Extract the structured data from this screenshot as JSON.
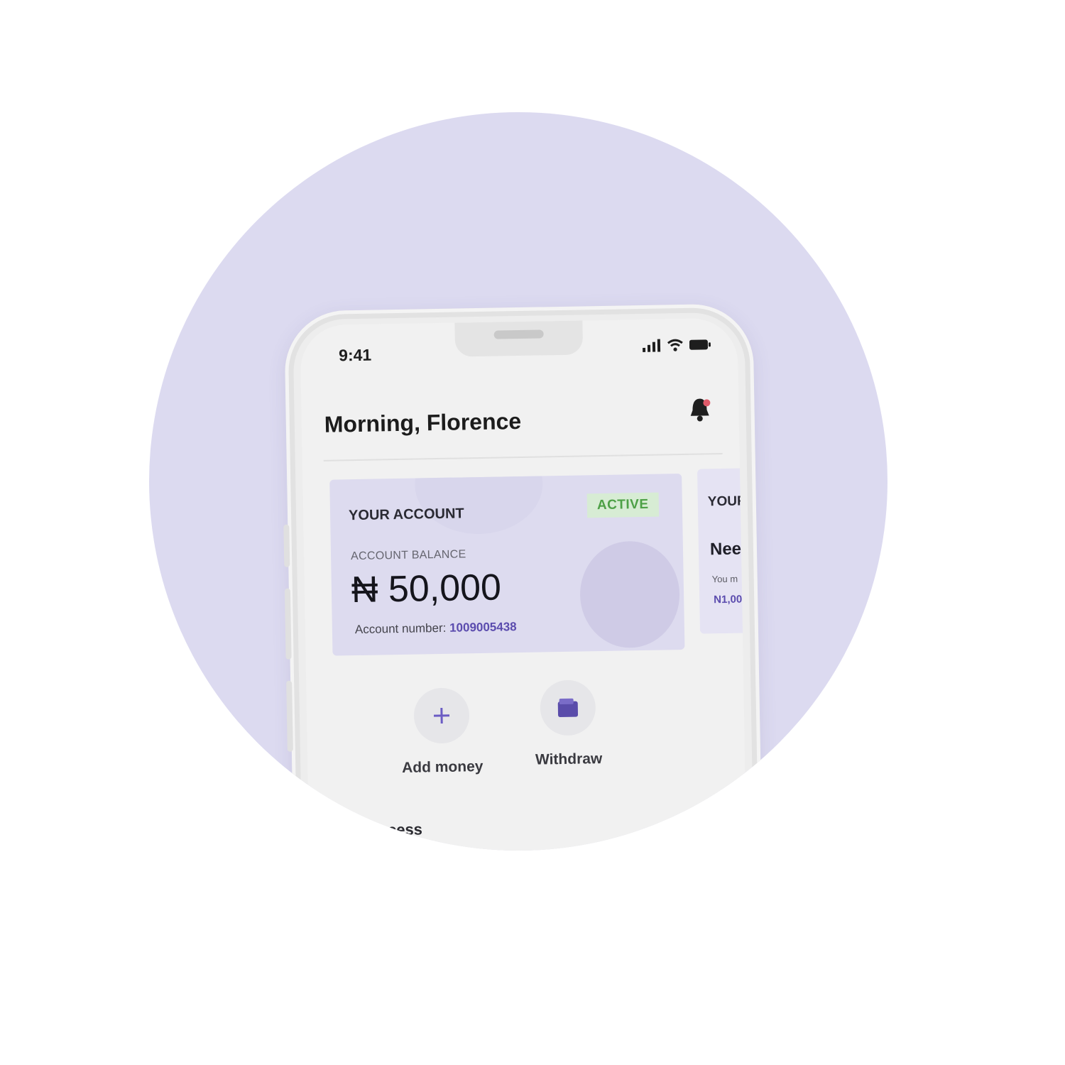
{
  "status_bar": {
    "time": "9:41"
  },
  "header": {
    "greeting": "Morning, Florence"
  },
  "account_card": {
    "title": "YOUR ACCOUNT",
    "badge": "ACTIVE",
    "balance_label": "ACCOUNT BALANCE",
    "balance": "₦ 50,000",
    "account_number_label": "Account number:",
    "account_number": "1009005438"
  },
  "second_card": {
    "title": "YOUR",
    "heading": "Nee",
    "subtext": "You m",
    "amount": "N1,00"
  },
  "actions": [
    {
      "label": "Add money",
      "icon": "plus-icon"
    },
    {
      "label": "Withdraw",
      "icon": "wallet-icon"
    }
  ],
  "section": {
    "quick_access": "ick access"
  },
  "colors": {
    "background_circle": "#dcdaf0",
    "card": "#dddbef",
    "accent": "#5b4cae",
    "badge_text": "#4da046",
    "badge_bg": "#d7ecd4"
  }
}
